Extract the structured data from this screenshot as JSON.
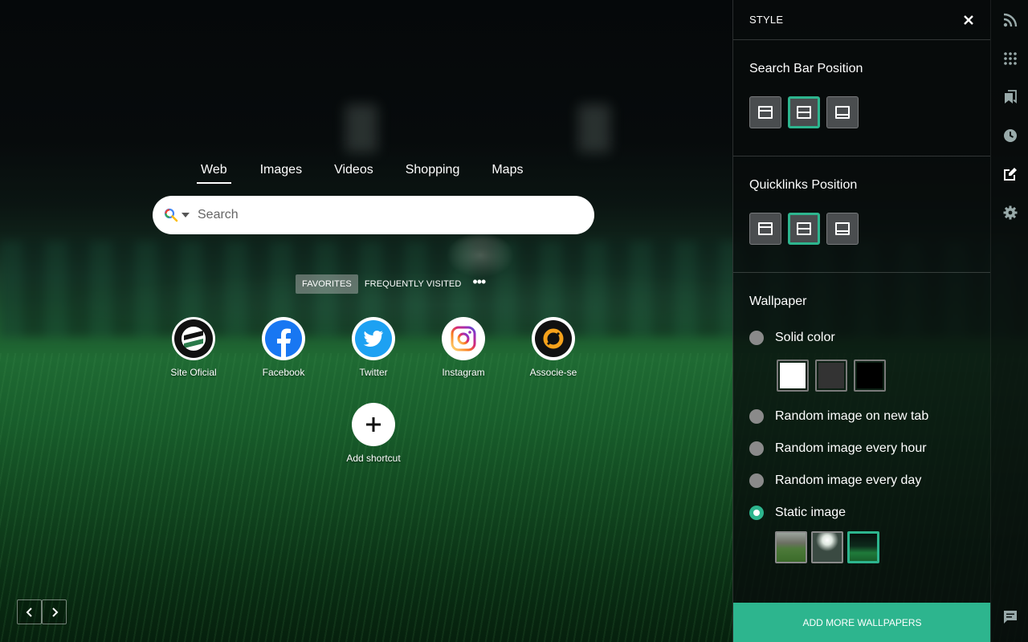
{
  "search": {
    "tabs": [
      {
        "label": "Web",
        "active": true
      },
      {
        "label": "Images",
        "active": false
      },
      {
        "label": "Videos",
        "active": false
      },
      {
        "label": "Shopping",
        "active": false
      },
      {
        "label": "Maps",
        "active": false
      }
    ],
    "placeholder": "Search",
    "engine_icon": "search-engine-icon"
  },
  "quicklinks": {
    "tabs": [
      {
        "label": "FAVORITES",
        "active": true
      },
      {
        "label": "FREQUENTLY VISITED",
        "active": false
      }
    ],
    "more_icon": "more-dots-icon",
    "items": [
      {
        "label": "Site Oficial",
        "icon": "club-crest-icon"
      },
      {
        "label": "Facebook",
        "icon": "facebook-icon"
      },
      {
        "label": "Twitter",
        "icon": "twitter-icon"
      },
      {
        "label": "Instagram",
        "icon": "instagram-icon"
      },
      {
        "label": "Associe-se",
        "icon": "associe-se-icon"
      }
    ],
    "add_label": "Add shortcut"
  },
  "nav": {
    "prev_icon": "chevron-left-icon",
    "next_icon": "chevron-right-icon"
  },
  "panel": {
    "title": "STYLE",
    "search_bar_position": {
      "title": "Search Bar Position",
      "options": [
        "top",
        "middle",
        "bottom"
      ],
      "selected": "middle"
    },
    "quicklinks_position": {
      "title": "Quicklinks Position",
      "options": [
        "top",
        "middle",
        "bottom"
      ],
      "selected": "middle"
    },
    "wallpaper": {
      "title": "Wallpaper",
      "options": [
        {
          "label": "Solid color",
          "checked": false
        },
        {
          "label": "Random image on new tab",
          "checked": false
        },
        {
          "label": "Random image every hour",
          "checked": false
        },
        {
          "label": "Random image every day",
          "checked": false
        },
        {
          "label": "Static image",
          "checked": true
        }
      ],
      "solid_colors": [
        "#ffffff",
        "#333333",
        "#000000"
      ],
      "thumbnails": [
        "stadium-day",
        "stadium-lights",
        "stadium-night"
      ],
      "selected_thumbnail": 2
    },
    "add_button": "ADD MORE WALLPAPERS"
  },
  "rail": {
    "icons": [
      "rss-icon",
      "apps-grid-icon",
      "bookmark-icon",
      "history-clock-icon",
      "style-edit-icon",
      "settings-gear-icon",
      "feedback-icon"
    ]
  },
  "colors": {
    "accent": "#2db58e",
    "panel_bg": "#0d1312"
  }
}
